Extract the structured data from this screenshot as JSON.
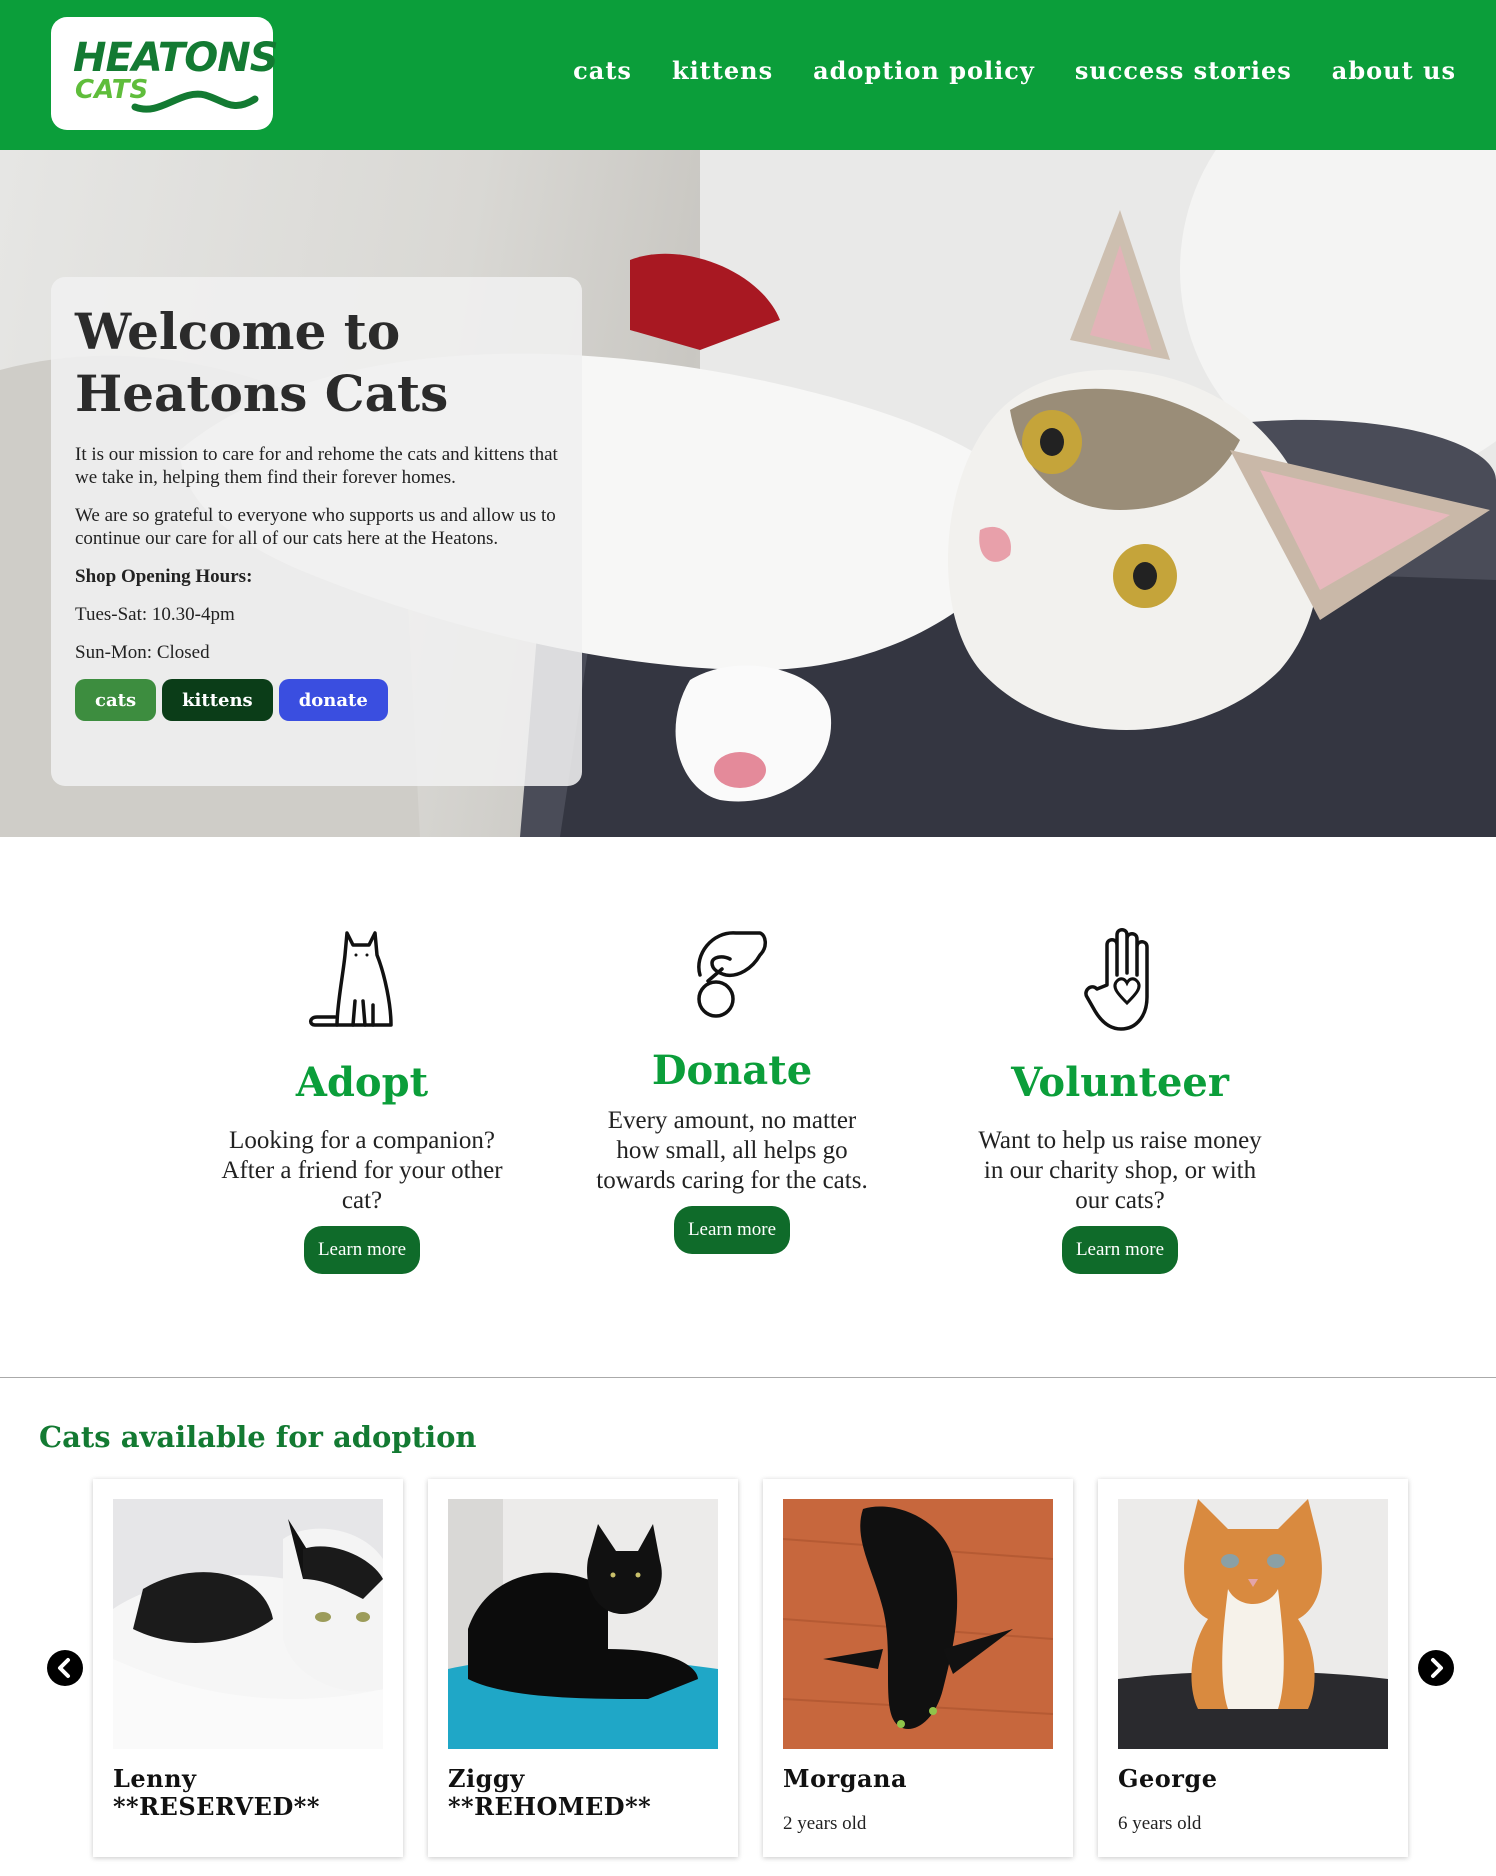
{
  "header": {
    "logo_text_1": "HEATONS",
    "logo_text_2": "CATS",
    "nav": [
      "cats",
      "kittens",
      "adoption policy",
      "success stories",
      "about us"
    ]
  },
  "hero": {
    "title": "Welcome to Heatons Cats",
    "para1": "It is our mission to care for and rehome the cats and kittens that we take in, helping them find their forever homes.",
    "para2": "We are so grateful to everyone who supports us and allow us to continue our care for all of our cats here at the Heatons.",
    "hours_title": "Shop Opening Hours:",
    "hours_1": "Tues-Sat: 10.30-4pm",
    "hours_2": "Sun-Mon: Closed",
    "buttons": [
      {
        "label": "cats",
        "color": "#3d8d3f"
      },
      {
        "label": "kittens",
        "color": "#0b3d18"
      },
      {
        "label": "donate",
        "color": "#3a4ee0"
      }
    ]
  },
  "features": [
    {
      "icon": "cat-icon",
      "title": "Adopt",
      "text": "Looking for a companion? After a friend for your other cat?",
      "button": "Learn more"
    },
    {
      "icon": "donate-hand-icon",
      "title": "Donate",
      "text": "Every amount, no matter how small, all helps go towards caring for the cats.",
      "button": "Learn more"
    },
    {
      "icon": "volunteer-hand-heart-icon",
      "title": "Volunteer",
      "text": "Want to help us raise money in our charity shop, or with our cats?",
      "button": "Learn more"
    }
  ],
  "adoption": {
    "title": "Cats available for adoption",
    "cats": [
      {
        "name": "Lenny **RESERVED**",
        "age": ""
      },
      {
        "name": "Ziggy **REHOMED**",
        "age": ""
      },
      {
        "name": "Morgana",
        "age": "2 years old"
      },
      {
        "name": "George",
        "age": "6 years old"
      }
    ]
  },
  "colors": {
    "brand_green": "#0b9e3a",
    "dark_green": "#0f6b2a"
  }
}
